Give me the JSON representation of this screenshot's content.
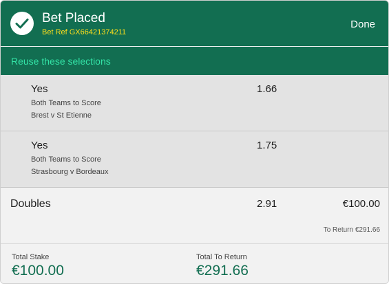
{
  "header": {
    "title": "Bet Placed",
    "bet_ref": "Bet Ref GX66421374211",
    "done_label": "Done",
    "check_icon": "check-circle-icon"
  },
  "reuse": {
    "label": "Reuse these selections"
  },
  "selections": [
    {
      "name": "Yes",
      "odds": "1.66",
      "market": "Both Teams to Score",
      "event": "Brest v St Etienne"
    },
    {
      "name": "Yes",
      "odds": "1.75",
      "market": "Both Teams to Score",
      "event": "Strasbourg v Bordeaux"
    }
  ],
  "doubles": {
    "label": "Doubles",
    "odds": "2.91",
    "stake": "€100.00",
    "to_return": "To Return  €291.66"
  },
  "footer": {
    "total_stake_label": "Total Stake",
    "total_stake_value": "€100.00",
    "total_return_label": "Total To Return",
    "total_return_value": "€291.66"
  },
  "colors": {
    "brand_green": "#126e51",
    "accent_yellow": "#ffdf1b",
    "link_green": "#33e3a6"
  }
}
